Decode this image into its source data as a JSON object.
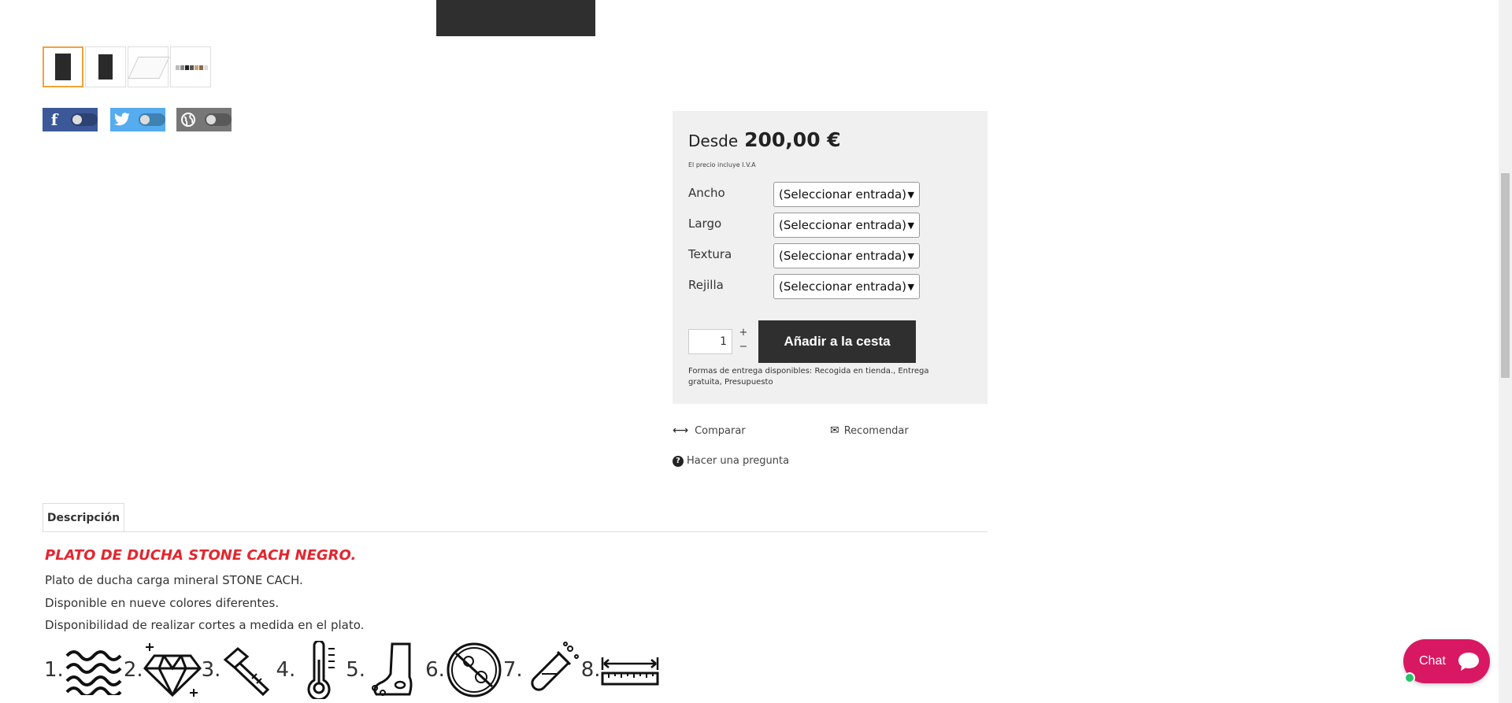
{
  "gallery": {
    "thumbnails": [
      "thumb-1",
      "thumb-2",
      "thumb-3",
      "thumb-4"
    ]
  },
  "social": [
    {
      "name": "facebook",
      "glyph": "f",
      "color": "#3b5998"
    },
    {
      "name": "twitter",
      "glyph": "t",
      "color": "#55acee"
    },
    {
      "name": "web",
      "glyph": "◍",
      "color": "#777777"
    }
  ],
  "buy_box": {
    "price_label": "Desde",
    "price_value": "200,00 €",
    "vat_note": "El precio incluye I.V.A",
    "options": [
      {
        "label": "Ancho",
        "value": "(Seleccionar entrada)"
      },
      {
        "label": "Largo",
        "value": "(Seleccionar entrada)"
      },
      {
        "label": "Textura",
        "value": "(Seleccionar entrada)"
      },
      {
        "label": "Rejilla",
        "value": "(Seleccionar entrada)"
      }
    ],
    "quantity": "1",
    "qty_plus": "+",
    "qty_minus": "−",
    "add_to_cart": "Añadir a la cesta",
    "delivery_text": "Formas de entrega disponibles: Recogida en tienda., Entrega gratuita, Presupuesto"
  },
  "links": {
    "compare": "Comparar",
    "recommend": "Recomendar",
    "ask": "Hacer una pregunta"
  },
  "tabs": {
    "description": "Descripción"
  },
  "description": {
    "title": "PLATO DE DUCHA STONE CACH NEGRO.",
    "lines": [
      "Plato de ducha carga mineral STONE CACH.",
      "Disponible en nueve colores diferentes.",
      "Disponibilidad de realizar cortes a medida en el plato."
    ],
    "features": [
      {
        "num": "1.",
        "icon": "waves-icon"
      },
      {
        "num": "2.",
        "icon": "diamond-icon"
      },
      {
        "num": "3.",
        "icon": "hammer-icon"
      },
      {
        "num": "4.",
        "icon": "thermometer-icon"
      },
      {
        "num": "5.",
        "icon": "foot-icon"
      },
      {
        "num": "6.",
        "icon": "antibacterial-icon"
      },
      {
        "num": "7.",
        "icon": "test-tube-icon"
      },
      {
        "num": "8.",
        "icon": "ruler-icon"
      }
    ]
  },
  "chat": {
    "label": "Chat",
    "color": "#d91863"
  }
}
